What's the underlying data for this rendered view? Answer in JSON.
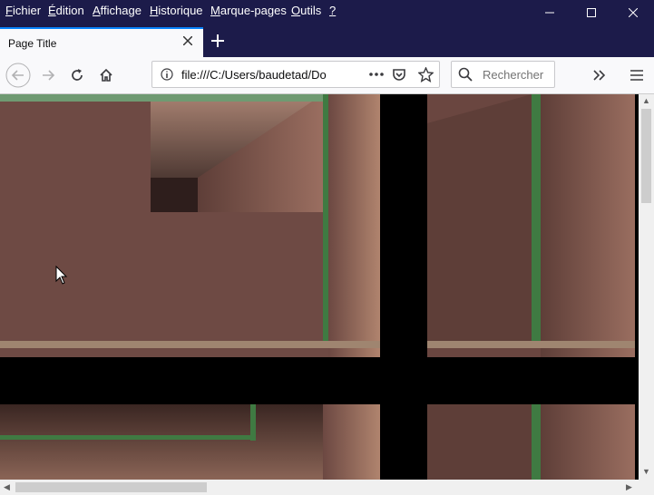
{
  "menubar": {
    "items": [
      "Fichier",
      "Édition",
      "Affichage",
      "Historique",
      "Marque-pages",
      "Outils",
      "?"
    ],
    "access_keys": [
      "F",
      "É",
      "A",
      "H",
      "M",
      "O",
      "?"
    ],
    "rest": [
      "ichier",
      "dition",
      "ffichage",
      "istorique",
      "arque-pages",
      "utils",
      ""
    ]
  },
  "tab": {
    "title": "Page Title"
  },
  "urlbar": {
    "value": "file:///C:/Users/baudetad/Do"
  },
  "searchbar": {
    "placeholder": "Rechercher"
  },
  "colors": {
    "titlebar": "#1c1b4a",
    "tab_accent": "#0a84ff",
    "wall": "#6e4a44",
    "wall_light": "#a47868",
    "trim_green": "#3f7a42"
  },
  "icons": [
    "back-icon",
    "forward-icon",
    "reload-icon",
    "home-icon",
    "info-icon",
    "page-actions-icon",
    "pocket-icon",
    "bookmark-star-icon",
    "search-icon",
    "overflow-icon",
    "menu-icon",
    "minimize-icon",
    "maximize-icon",
    "close-icon"
  ]
}
